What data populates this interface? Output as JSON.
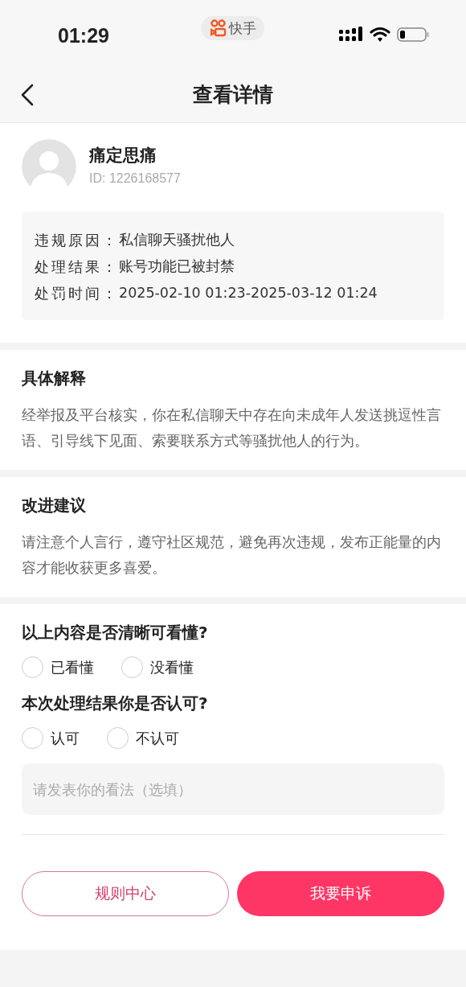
{
  "status_bar": {
    "time": "01:29",
    "app_badge": "快手"
  },
  "nav": {
    "title": "查看详情"
  },
  "user": {
    "name": "痛定思痛",
    "id": "ID: 1226168577"
  },
  "details": [
    {
      "label": "违规原因：",
      "value": "私信聊天骚扰他人"
    },
    {
      "label": "处理结果：",
      "value": "账号功能已被封禁"
    },
    {
      "label": "处罚时间：",
      "value": "2025-02-10 01:23-2025-03-12 01:24"
    }
  ],
  "sections": [
    {
      "title": "具体解释",
      "body": "经举报及平台核实，你在私信聊天中存在向未成年人发送挑逗性言语、引导线下见面、索要联系方式等骚扰他人的行为。"
    },
    {
      "title": "改进建议",
      "body": "请注意个人言行，遵守社区规范，避免再次违规，发布正能量的内容才能收获更多喜爱。"
    }
  ],
  "questions": [
    {
      "title": "以上内容是否清晰可看懂?",
      "options": [
        {
          "label": "已看懂",
          "selected": false
        },
        {
          "label": "没看懂",
          "selected": false
        }
      ]
    },
    {
      "title": "本次处理结果你是否认可?",
      "options": [
        {
          "label": "认可",
          "selected": false
        },
        {
          "label": "不认可",
          "selected": false
        }
      ]
    }
  ],
  "comment": {
    "placeholder": "请发表你的看法（选填）"
  },
  "buttons": [
    {
      "label": "规则中心",
      "kind": "outline"
    },
    {
      "label": "我要申诉",
      "kind": "primary"
    }
  ]
}
